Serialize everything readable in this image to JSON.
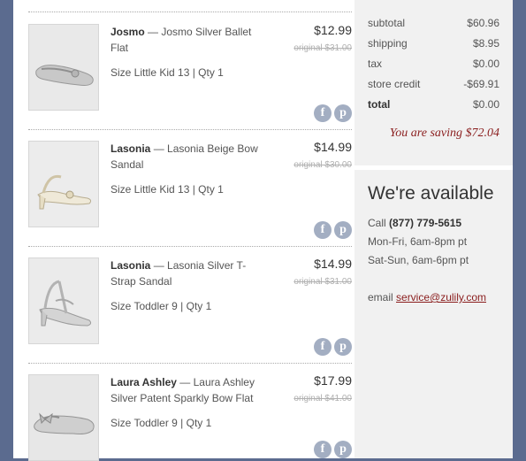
{
  "items": [
    {
      "brand": "Josmo",
      "dash": " — ",
      "title": "Josmo Silver Ballet Flat",
      "size_qty": "Size Little Kid 13 | Qty 1",
      "price": "$12.99",
      "original": "original $31.00",
      "image_icon": "ballet-flat-shoe-image"
    },
    {
      "brand": "Lasonia",
      "dash": " — ",
      "title": "Lasonia Beige Bow Sandal",
      "size_qty": "Size Little Kid 13 | Qty 1",
      "price": "$14.99",
      "original": "original $30.00",
      "image_icon": "heeled-sandal-image"
    },
    {
      "brand": "Lasonia",
      "dash": " — ",
      "title": "Lasonia Silver T-Strap Sandal",
      "size_qty": "Size Toddler 9 | Qty 1",
      "price": "$14.99",
      "original": "original $31.00",
      "image_icon": "t-strap-sandal-image"
    },
    {
      "brand": "Laura Ashley",
      "dash": " — ",
      "title": "Laura Ashley Silver Patent Sparkly Bow Flat",
      "size_qty": "Size Toddler 9 | Qty 1",
      "price": "$17.99",
      "original": "original $41.00",
      "image_icon": "bow-flat-shoe-image"
    }
  ],
  "social": {
    "facebook_glyph": "f",
    "pinterest_glyph": "p"
  },
  "totals": {
    "subtotal_label": "subtotal",
    "subtotal": "$60.96",
    "shipping_label": "shipping",
    "shipping": "$8.95",
    "tax_label": "tax",
    "tax": "$0.00",
    "credit_label": "store credit",
    "credit": "-$69.91",
    "total_label": "total",
    "total": "$0.00"
  },
  "saving": "You are saving $72.04",
  "available": {
    "heading": "We're available",
    "call_label": "Call ",
    "phone": "(877) 779-5615",
    "weekday_hours": "Mon-Fri, 6am-8pm pt",
    "weekend_hours": "Sat-Sun, 6am-6pm pt",
    "email_label": "email ",
    "email": "service@zulily.com"
  },
  "colors": {
    "background": "#5b6b8f",
    "accent": "#8a1d1d",
    "social_icon": "#a3aec2",
    "sidebar": "#f1f1f1"
  }
}
